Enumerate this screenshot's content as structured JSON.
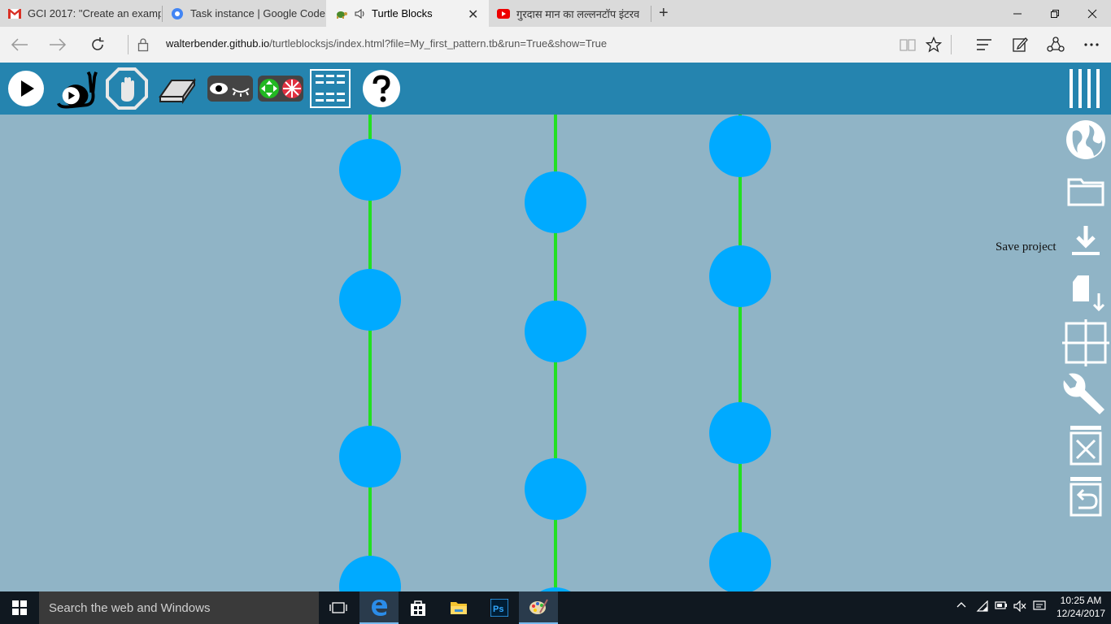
{
  "browser": {
    "tabs": [
      {
        "label": "GCI 2017: \"Create an exampl",
        "icon": "gmail-icon",
        "active": false
      },
      {
        "label": "Task instance | Google Code",
        "icon": "gear-icon",
        "active": false
      },
      {
        "label": "Turtle Blocks",
        "icon": "turtle-icon",
        "active": true
      },
      {
        "label": "गुरदास मान का लल्लनटॉप इंटरव",
        "icon": "youtube-icon",
        "active": false
      }
    ],
    "new_tab": "+",
    "close_tab": "✕",
    "url_host": "walterbender.github.io",
    "url_path": "/turtleblocksjs/index.html?file=My_first_pattern.tb&run=True&show=True"
  },
  "toolbar": {
    "buttons": [
      "run-icon",
      "slow-run-icon",
      "stop-icon",
      "clear-icon",
      "show-hide-blocks-icon",
      "collapse-expand-icon",
      "palette-grid-icon",
      "help-icon"
    ]
  },
  "palette_right": {
    "buttons": [
      "menu-icon",
      "planet-icon",
      "open-folder-icon",
      "save-project-icon",
      "save-file-icon",
      "grid-icon",
      "wrench-icon",
      "delete-icon",
      "restore-trash-icon"
    ],
    "tooltip": "Save project"
  },
  "taskbar": {
    "search_placeholder": "Search the web and Windows",
    "time": "10:25 AM",
    "date": "12/24/2017"
  },
  "colors": {
    "canvas": "#90b4c6",
    "toolbar": "#2584af",
    "dot": "#00aaff",
    "line": "#22e022"
  }
}
